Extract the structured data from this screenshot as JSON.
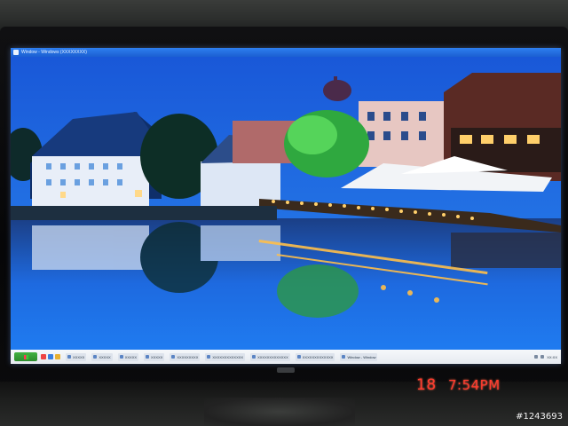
{
  "window": {
    "title": "Window - Windows (XXXXXXXX)"
  },
  "taskbar": {
    "start_label": "start",
    "items": [
      {
        "label": "XXXXX"
      },
      {
        "label": "XXXXX"
      },
      {
        "label": "XXXXX"
      },
      {
        "label": "XXXXX"
      },
      {
        "label": "XXXXXXXXX"
      },
      {
        "label": "XXXXXXXXXXXXX"
      },
      {
        "label": "XXXXXXXXXXXXX"
      },
      {
        "label": "XXXXXXXXXXXXX"
      },
      {
        "label": "Window - Window"
      }
    ],
    "clock": "XX:XX"
  },
  "camera_overlay": {
    "date": "18",
    "time": "7:54PM"
  },
  "image_id": "#1243693",
  "colors": {
    "sky": "#1a6be0",
    "water": "#1e74e6",
    "titlebar": "#1b5fd1",
    "lights": "#ffcf6a",
    "overlay_text": "#ff3b2f"
  }
}
